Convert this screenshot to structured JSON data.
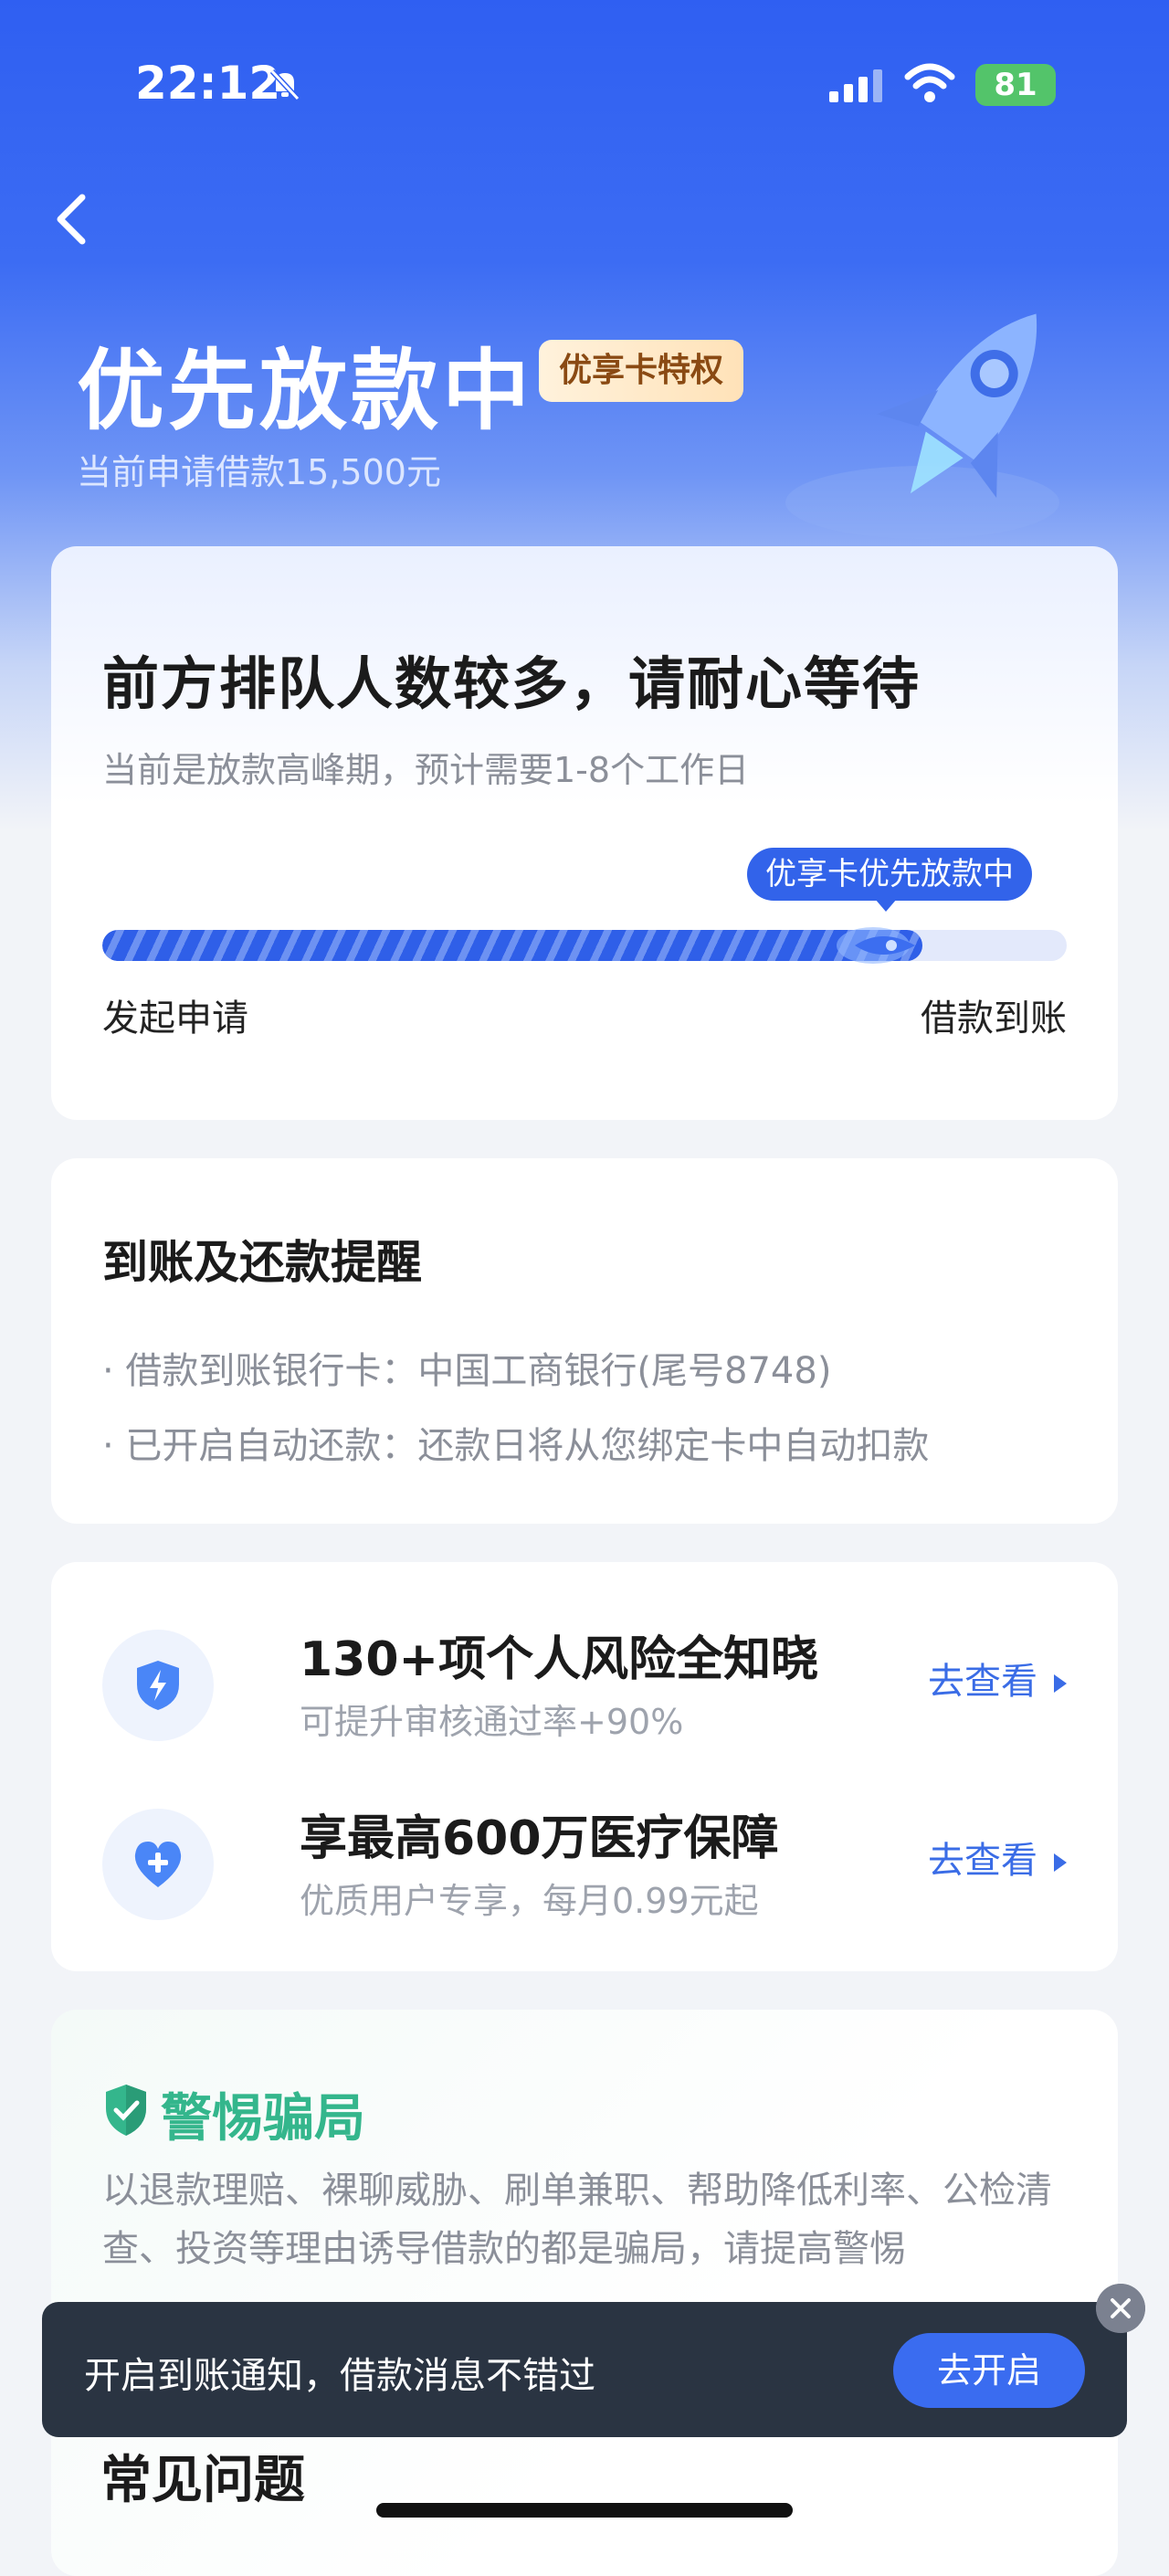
{
  "status_bar": {
    "time": "22:12",
    "battery": "81"
  },
  "header": {
    "title": "优先放款中",
    "badge": "优享卡特权",
    "subtitle": "当前申请借款15,500元"
  },
  "queue_card": {
    "title": "前方排队人数较多，请耐心等待",
    "description": "当前是放款高峰期，预计需要1-8个工作日",
    "progress_tag": "优享卡优先放款中",
    "progress_percent": 85,
    "start_label": "发起申请",
    "end_label": "借款到账"
  },
  "reminder_card": {
    "title": "到账及还款提醒",
    "lines": [
      "· 借款到账银行卡：中国工商银行(尾号8748)",
      "· 已开启自动还款：还款日将从您绑定卡中自动扣款"
    ]
  },
  "services": [
    {
      "icon": "shield-bolt-icon",
      "title": "130+项个人风险全知晓",
      "subtitle": "可提升审核通过率+90%",
      "link": "去查看"
    },
    {
      "icon": "heart-plus-icon",
      "title": "享最高600万医疗保障",
      "subtitle": "优质用户专享，每月0.99元起",
      "link": "去查看"
    }
  ],
  "fraud_card": {
    "title": "警惕骗局",
    "text": "以退款理赔、裸聊威胁、刷单兼职、帮助降低利率、公检清查、投资等理由诱导借款的都是骗局，请提高警惕"
  },
  "faq": {
    "title": "常见问题"
  },
  "toast": {
    "text": "开启到账通知，借款消息不错过",
    "button": "去开启"
  },
  "colors": {
    "primary": "#3263ea",
    "green": "#34b68c",
    "toast_bg": "#2a3442"
  }
}
